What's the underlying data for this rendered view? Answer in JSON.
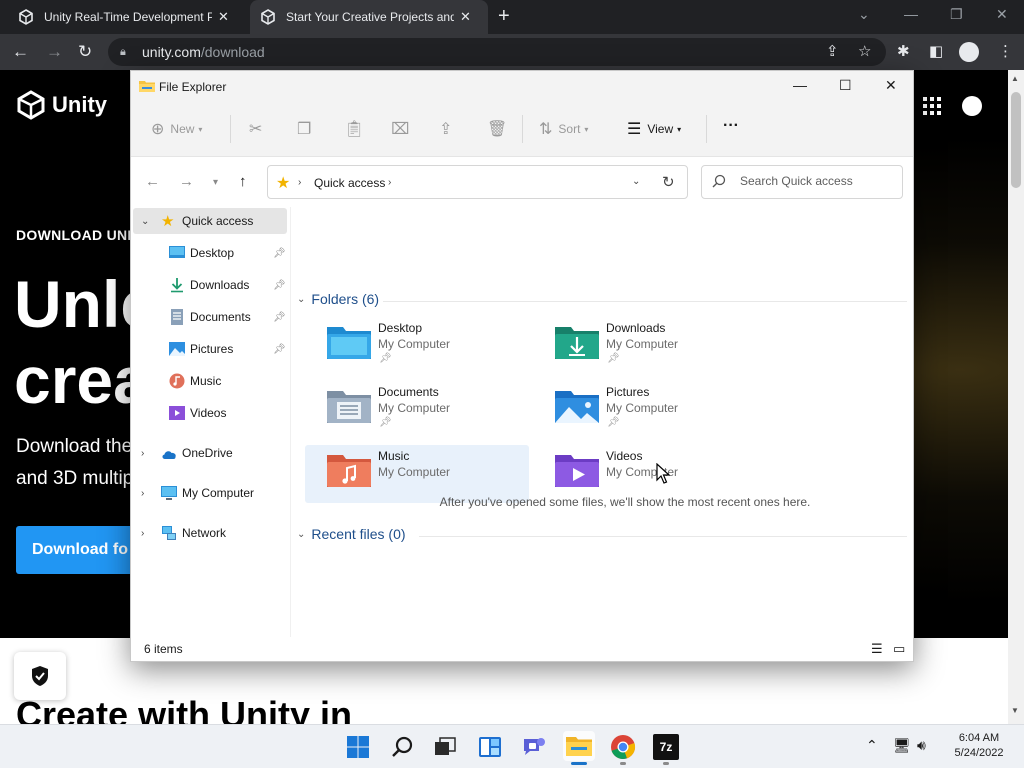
{
  "browser": {
    "tabs": [
      {
        "title": "Unity Real-Time Development Pl",
        "close": "✕"
      },
      {
        "title": "Start Your Creative Projects and D",
        "close": "✕"
      }
    ],
    "new_tab": "+",
    "address": {
      "host": "unity.com",
      "path": "/download"
    }
  },
  "page": {
    "logo_text": "Unity",
    "eyebrow": "DOWNLOAD UNI",
    "hero_line1": "Unle",
    "hero_line2": "crea",
    "sub_line1": "Download the",
    "sub_line2": "and 3D multip",
    "download_btn": "Download fo",
    "create_heading": "Create with Unity in"
  },
  "explorer": {
    "title": "File Explorer",
    "toolbar": {
      "new": "New",
      "sort": "Sort",
      "view": "View",
      "more": "···"
    },
    "address_crumb": "Quick access",
    "search_placeholder": "Search Quick access",
    "nav": {
      "quick_access": "Quick access",
      "desktop": "Desktop",
      "downloads": "Downloads",
      "documents": "Documents",
      "pictures": "Pictures",
      "music": "Music",
      "videos": "Videos",
      "onedrive": "OneDrive",
      "my_computer": "My Computer",
      "network": "Network"
    },
    "folders_header": "Folders (6)",
    "folders": [
      {
        "name": "Desktop",
        "location": "My Computer"
      },
      {
        "name": "Downloads",
        "location": "My Computer"
      },
      {
        "name": "Documents",
        "location": "My Computer"
      },
      {
        "name": "Pictures",
        "location": "My Computer"
      },
      {
        "name": "Music",
        "location": "My Computer"
      },
      {
        "name": "Videos",
        "location": "My Computer"
      }
    ],
    "recent_header": "Recent files (0)",
    "recent_empty": "After you've opened some files, we'll show the most recent ones here.",
    "status_count": "6 items"
  },
  "taskbar": {
    "time": "6:04 AM",
    "date": "5/24/2022",
    "apps": [
      "start-icon",
      "search-icon",
      "task-view-icon",
      "widgets-icon",
      "chat-icon",
      "file-explorer-icon",
      "chrome-icon",
      "7zip-icon"
    ]
  },
  "colors": {
    "chrome_dark": "#202124",
    "unity_blue": "#2196f3",
    "group_header": "#1f4f8b",
    "selection": "#e5e5e5",
    "hover": "#e8f1fb"
  }
}
